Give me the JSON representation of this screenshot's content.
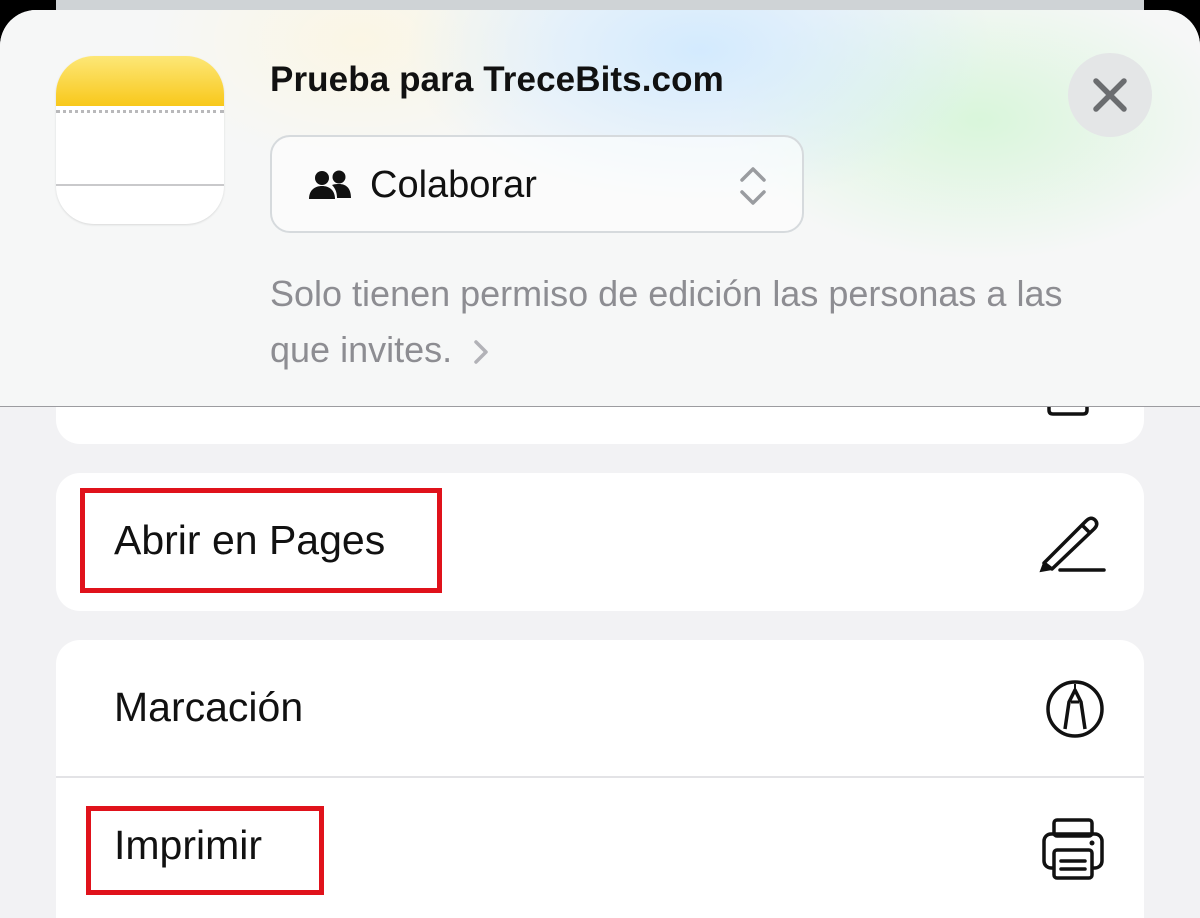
{
  "sheet": {
    "title": "Prueba para TreceBits.com",
    "app_icon": "notes-app-icon",
    "close_icon": "close-x-icon"
  },
  "collaborate": {
    "label": "Colaborar",
    "icon": "people-icon",
    "selector_icon": "chevron-up-down-icon"
  },
  "permission_note": {
    "text": "Solo tienen permiso de edición las personas a las que invites.",
    "icon": "chevron-right-icon"
  },
  "actions": [
    {
      "label": "Abrir en Pages",
      "icon": "pen-nib-icon"
    },
    {
      "label": "Marcación",
      "icon": "markup-pen-circle-icon"
    },
    {
      "label": "Imprimir",
      "icon": "printer-icon"
    }
  ],
  "annotations": {
    "highlight_color": "#e0121b"
  }
}
